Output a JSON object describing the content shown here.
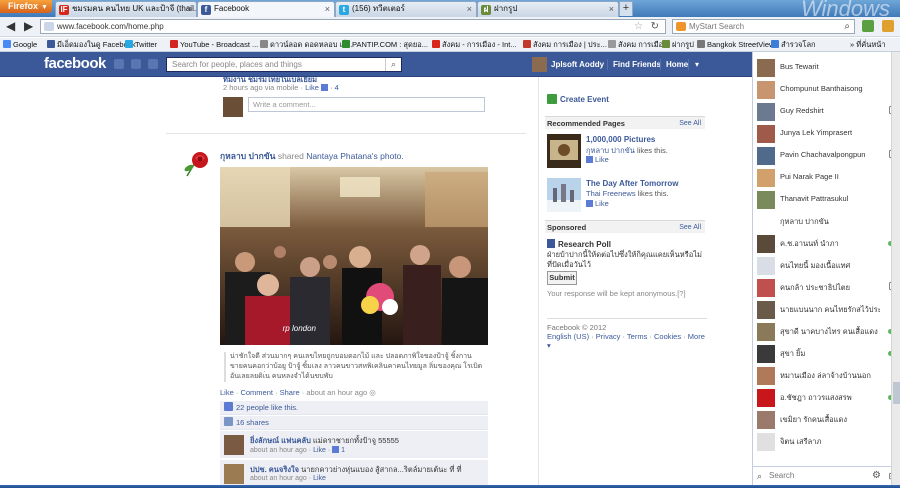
{
  "browser": {
    "menu_label": "Firefox",
    "tabs": [
      {
        "label": "ชมรมคน คนไทย UK และป้าจี (thail...",
        "icon": "IF"
      },
      {
        "label": "Facebook",
        "icon": "f"
      },
      {
        "label": "(156) ทวีตเตอร์",
        "icon": "t"
      },
      {
        "label": "ฝากรูป",
        "icon": "ฝ"
      }
    ],
    "url": "www.facebook.com/home.php",
    "search_placeholder": "MyStart Search",
    "bookmarks": [
      "Google",
      "มีเอ็ดมองในดู Facebook",
      "Twitter",
      "YouTube - Broadcast ...",
      "ดาวน์ลอด ดอดหลอบ เว็...",
      "PANTIP.COM : สุดยอ...",
      "สังคม - การเมือง - Int...",
      "สังคม การเมือง | ประ...",
      "สังคม การเมือง",
      "ฝากรูป",
      "Bangkok StreetView",
      "สำรวจโลก"
    ],
    "bookmarks_more": "ที่คั่นหน้า"
  },
  "facebook": {
    "logo": "facebook",
    "search_placeholder": "Search for people, places and things",
    "user_name": "Jplsoft Aoddy",
    "find_friends": "Find Friends",
    "home": "Home"
  },
  "feed": {
    "prev_post": {
      "name": "ทีมงาน ชมรมไทยในเบลเยี่ยม",
      "meta_time": "2 hours ago via mobile ·",
      "like_label": "Like",
      "like_count": "· 4",
      "comment_placeholder": "Write a comment..."
    },
    "post": {
      "author": "กุหลาบ ปากขัน",
      "shared_text": "shared",
      "shared_source": "Nantaya Phatana's photo.",
      "photo_credit": "rp london",
      "caption": "น่าชักใจดี ส่วนมากๆ คนเลขไทยถูกบอมดอกไม้ และ ปลอดภาพิใจของป้าจู้ ชิ้งกาน ขายคนคอกว่าบ้อยู ป้าจู้ ซิ้มเลง ลาวคนขาวสหพิเคลินคาคนไทยมูล ลิ่มของคุณ โรเบิด อันเลยลยดิเ่น คนหลงจำได้นขบพับ",
      "actions": {
        "like": "Like",
        "comment": "Comment",
        "share": "Share",
        "time": "about an hour ago"
      },
      "likes": "22 people like this.",
      "shares": "16 shares",
      "comments": [
        {
          "name": "ยิ่งลักษณ์ แฟนคลับ",
          "text": "แม่ดราชายกทั้งป้าจู 55555",
          "time": "about an hour ago",
          "like": "Like",
          "count": "1"
        },
        {
          "name": "ปปช. คนจริงใจ",
          "text": "นายกคาวย่างหุ่นแบอง สู้สากล...ริตล์มายเต้นะ ที่ ที่",
          "time": "about an hour ago",
          "like": "Like",
          "count": ""
        }
      ]
    }
  },
  "right_column": {
    "create_event": "Create Event",
    "recommended_title": "Recommended Pages",
    "see_all": "See All",
    "pages": [
      {
        "title": "1,000,000 Pictures",
        "liker": "กุหลาบ ปากขัน",
        "likes_this": "likes this.",
        "like": "Like"
      },
      {
        "title": "The Day After Tomorrow",
        "liker": "Thai Freenews",
        "likes_this": "likes this.",
        "like": "Like"
      }
    ],
    "sponsored_title": "Sponsored",
    "poll_title": "Research Poll",
    "poll_question": "ฝ่ายบ้าปากนี้ให้ดต่อไปซึ่งให้กิคุณแคยเห็นหรือไม่ที่ปัดเมื่อวันไว้",
    "poll_submit": "Submit",
    "poll_note": "Your response will be kept anonymous.[?]",
    "footer_copy": "Facebook © 2012",
    "footer_links": [
      "English (US)",
      "Privacy",
      "Terms",
      "Cookies",
      "More"
    ]
  },
  "chat": {
    "friends": [
      {
        "name": "Bus Tewarit",
        "status": "none"
      },
      {
        "name": "Chompunut Banthaisong",
        "status": "none"
      },
      {
        "name": "Guy Redshirt",
        "status": "mobile"
      },
      {
        "name": "Junya Lek Yimprasert",
        "status": "none"
      },
      {
        "name": "Pavin Chachavalpongpun",
        "status": "mobile"
      },
      {
        "name": "Pui Narak Page II",
        "status": "none"
      },
      {
        "name": "Thanavit Pattrasukul",
        "status": "none"
      },
      {
        "name": "กุหลาบ ปากขัน",
        "status": "none"
      },
      {
        "name": "ค.ช.อานนท์ นำภา",
        "status": "online"
      },
      {
        "name": "คนไทยนี้ มองเนื้อแทศ",
        "status": "none"
      },
      {
        "name": "คนกล้า ประชาธิปไตย",
        "status": "mobile"
      },
      {
        "name": "นายแบนนาก คนไทยรักสไว้ประ...",
        "status": "none"
      },
      {
        "name": "สุขาดี นาคบางไทร คนเสื้อแดง",
        "status": "online"
      },
      {
        "name": "สุขา ยิ้ม",
        "status": "online"
      },
      {
        "name": "หมานเมือง ล่ลาจ้างบ้านนอก",
        "status": "none"
      },
      {
        "name": "อ.ชัชฎา ถาวรแสงสรพ",
        "status": "online"
      },
      {
        "name": "เขมิยา รักคนเสื้อแดง",
        "status": "none"
      },
      {
        "name": "จิตน เสรีลาภ",
        "status": "none"
      }
    ],
    "search_placeholder": "Search"
  }
}
